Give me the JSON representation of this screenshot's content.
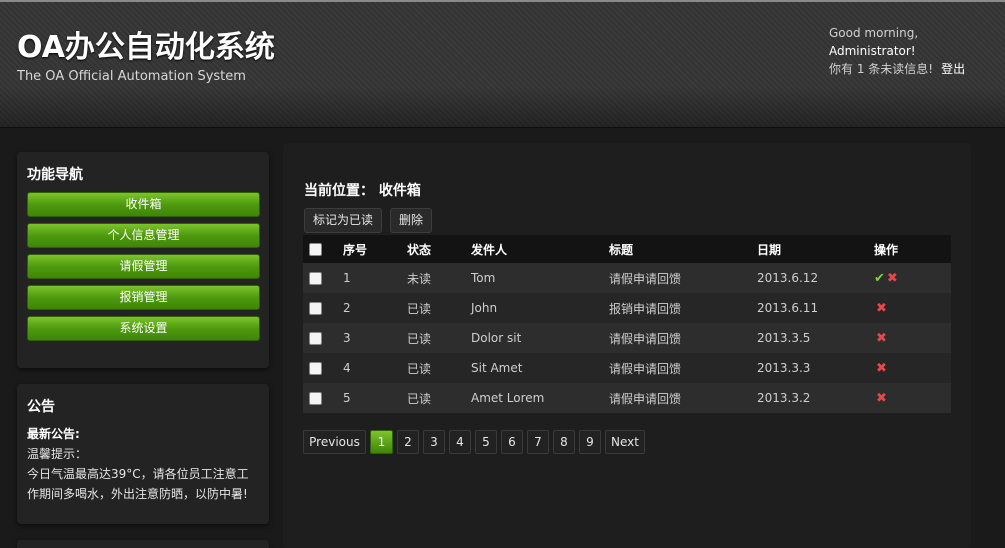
{
  "header": {
    "title": "OA办公自动化系统",
    "subtitle": "The OA Official Automation System",
    "greeting_prefix": "Good morning, ",
    "username": "Administrator!",
    "unread_text": "你有 1 条未读信息!",
    "logout_label": "登出"
  },
  "nav": {
    "title": "功能导航",
    "items": [
      "收件箱",
      "个人信息管理",
      "请假管理",
      "报销管理",
      "系统设置"
    ]
  },
  "notice": {
    "title": "公告",
    "heading": "最新公告:",
    "greeting": "温馨提示：",
    "line1": "今日气温最高达39°C，请各位员工注意工",
    "line2": "作期间多喝水，外出注意防晒，以防中暑!"
  },
  "main": {
    "breadcrumb": "当前位置：  收件箱",
    "mark_read_label": "标记为已读",
    "delete_label": "删除"
  },
  "table": {
    "headers": [
      "序号",
      "状态",
      "发件人",
      "标题",
      "日期",
      "操作"
    ],
    "rows": [
      {
        "no": "1",
        "status": "未读",
        "sender": "Tom",
        "subject": "请假申请回馈",
        "date": "2013.6.12"
      },
      {
        "no": "2",
        "status": "已读",
        "sender": "John",
        "subject": "报销申请回馈",
        "date": "2013.6.11"
      },
      {
        "no": "3",
        "status": "已读",
        "sender": "Dolor sit",
        "subject": "请假申请回馈",
        "date": "2013.3.5"
      },
      {
        "no": "4",
        "status": "已读",
        "sender": "Sit Amet",
        "subject": "请假申请回馈",
        "date": "2013.3.3"
      },
      {
        "no": "5",
        "status": "已读",
        "sender": "Amet Lorem",
        "subject": "请假申请回馈",
        "date": "2013.3.2"
      }
    ],
    "action_icons": {
      "approve": "check-icon",
      "delete": "close-icon"
    },
    "approve_glyph": "✔",
    "delete_glyph": "✖"
  },
  "pagination": {
    "previous_label": "Previous",
    "pages": [
      "1",
      "2",
      "3",
      "4",
      "5",
      "6",
      "7",
      "8",
      "9"
    ],
    "active_page": "1",
    "next_label": "Next"
  },
  "colors": {
    "accent_green": "#4f9a0f",
    "approve_green": "#7fd33a",
    "delete_red": "#e8484b",
    "background": "#1a1a1a"
  }
}
